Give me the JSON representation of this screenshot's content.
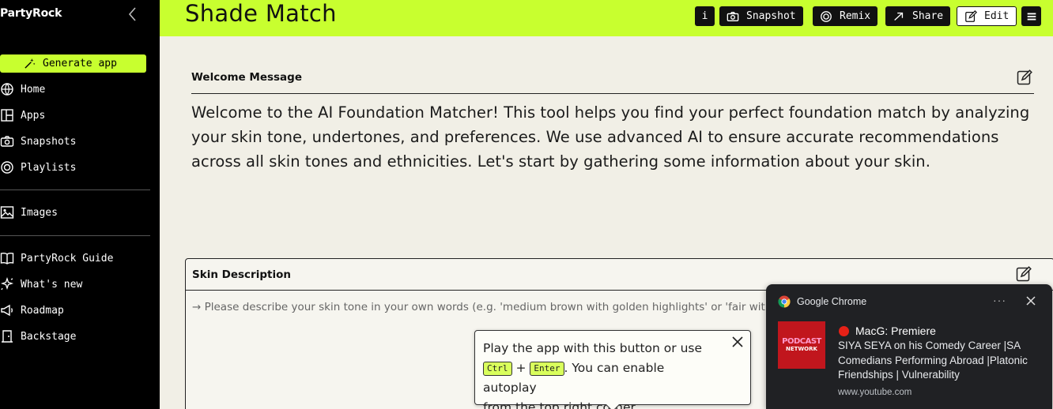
{
  "sidebar": {
    "brand": "PartyRock",
    "generate_label": "Generate app",
    "items": [
      {
        "label": "Home",
        "icon": "globe-icon"
      },
      {
        "label": "Apps",
        "icon": "apps-icon"
      },
      {
        "label": "Snapshots",
        "icon": "camera-icon"
      },
      {
        "label": "Playlists",
        "icon": "playlist-icon"
      },
      {
        "label": "Images",
        "icon": "images-icon"
      },
      {
        "label": "PartyRock Guide",
        "icon": "book-icon"
      },
      {
        "label": "What's new",
        "icon": "sparkle-icon"
      },
      {
        "label": "Roadmap",
        "icon": "megaphone-icon"
      },
      {
        "label": "Backstage",
        "icon": "door-icon"
      }
    ]
  },
  "header": {
    "title": "Shade Match",
    "info_label": "i",
    "snapshot_label": "Snapshot",
    "remix_label": "Remix",
    "share_label": "Share",
    "edit_label": "Edit"
  },
  "welcome": {
    "label": "Welcome Message",
    "text": "Welcome to the AI Foundation Matcher! This tool helps you find your perfect foundation match by analyzing your skin tone, undertones, and preferences. We use advanced AI to ensure accurate recommendations across all skin tones and ethnicities. Let's start by gathering some information about your skin."
  },
  "skin": {
    "label": "Skin Description",
    "placeholder": "→ Please describe your skin tone in your own words (e.g. 'medium brown with golden highlights' or 'fair with pin"
  },
  "tooltip": {
    "line1": "Play the app with this button or use",
    "key1": "Ctrl",
    "plus": "+",
    "key2": "Enter",
    "line2": ". You can enable autoplay",
    "line3": "from the top right corner."
  },
  "notification": {
    "app": "Google Chrome",
    "thumb_line1": "PODCAST",
    "thumb_line2": "NETWORK",
    "headline": "MacG: Premiere",
    "body": "SIYA SEYA on his Comedy Career |SA Comedians Performing Abroad |Platonic Friendships | Vulnerability",
    "source": "www.youtube.com",
    "more": "···"
  },
  "colors": {
    "accent": "#c8ff2f",
    "sidebar_bg": "#000000",
    "page_bg": "#f1efe6",
    "notification_bg": "#202124"
  }
}
